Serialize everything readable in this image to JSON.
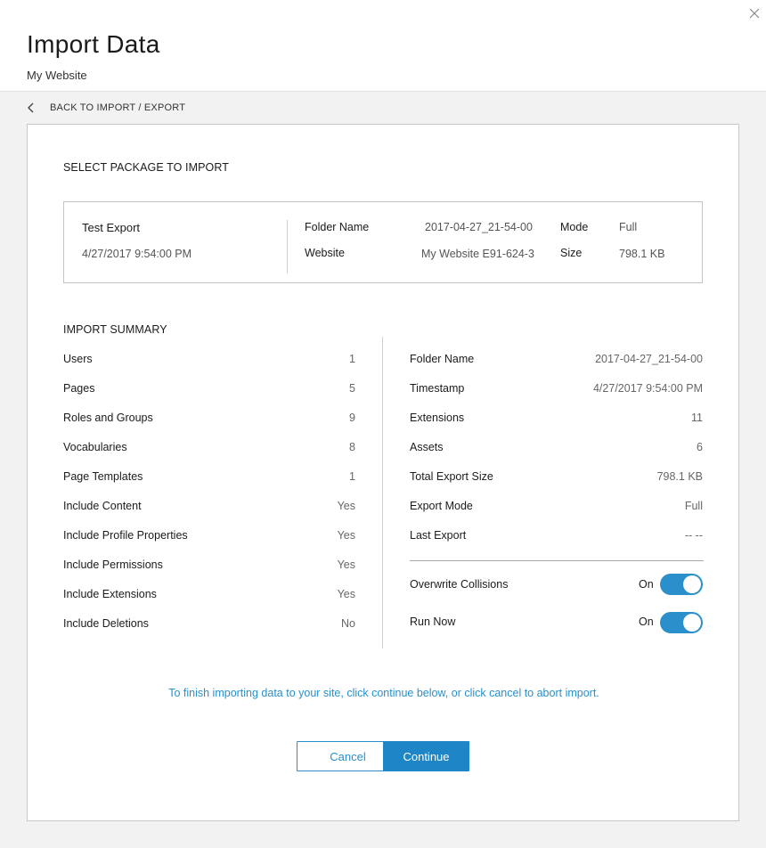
{
  "header": {
    "title": "Import Data",
    "subtitle": "My Website"
  },
  "icons": {
    "close": "close-icon",
    "back": "chevron-left-icon"
  },
  "nav": {
    "back_label": "BACK TO IMPORT / EXPORT"
  },
  "package_section": {
    "title": "SELECT PACKAGE TO IMPORT",
    "name": "Test Export",
    "date": "4/27/2017 9:54:00 PM",
    "folder_name_label": "Folder Name",
    "folder_name_value": "2017-04-27_21-54-00",
    "website_label": "Website",
    "website_value": "My Website E91-624-3",
    "mode_label": "Mode",
    "mode_value": "Full",
    "size_label": "Size",
    "size_value": "798.1 KB"
  },
  "summary": {
    "title": "IMPORT SUMMARY",
    "left": [
      {
        "label": "Users",
        "value": "1"
      },
      {
        "label": "Pages",
        "value": "5"
      },
      {
        "label": "Roles and Groups",
        "value": "9"
      },
      {
        "label": "Vocabularies",
        "value": "8"
      },
      {
        "label": "Page Templates",
        "value": "1"
      },
      {
        "label": "Include Content",
        "value": "Yes"
      },
      {
        "label": "Include Profile Properties",
        "value": "Yes"
      },
      {
        "label": "Include Permissions",
        "value": "Yes"
      },
      {
        "label": "Include Extensions",
        "value": "Yes"
      },
      {
        "label": "Include Deletions",
        "value": "No"
      }
    ],
    "right": [
      {
        "label": "Folder Name",
        "value": "2017-04-27_21-54-00"
      },
      {
        "label": "Timestamp",
        "value": "4/27/2017 9:54:00 PM"
      },
      {
        "label": "Extensions",
        "value": "11"
      },
      {
        "label": "Assets",
        "value": "6"
      },
      {
        "label": "Total Export Size",
        "value": "798.1 KB"
      },
      {
        "label": "Export Mode",
        "value": "Full"
      },
      {
        "label": "Last Export",
        "value": "-- --"
      }
    ],
    "toggles": [
      {
        "label": "Overwrite Collisions",
        "state_label": "On",
        "on": true
      },
      {
        "label": "Run Now",
        "state_label": "On",
        "on": true
      }
    ]
  },
  "footer": {
    "info": "To finish importing data to your site, click continue below, or click cancel to abort import.",
    "cancel_label": "Cancel",
    "continue_label": "Continue"
  },
  "colors": {
    "accent": "#2a8fca",
    "primary_button": "#1e85c6"
  }
}
